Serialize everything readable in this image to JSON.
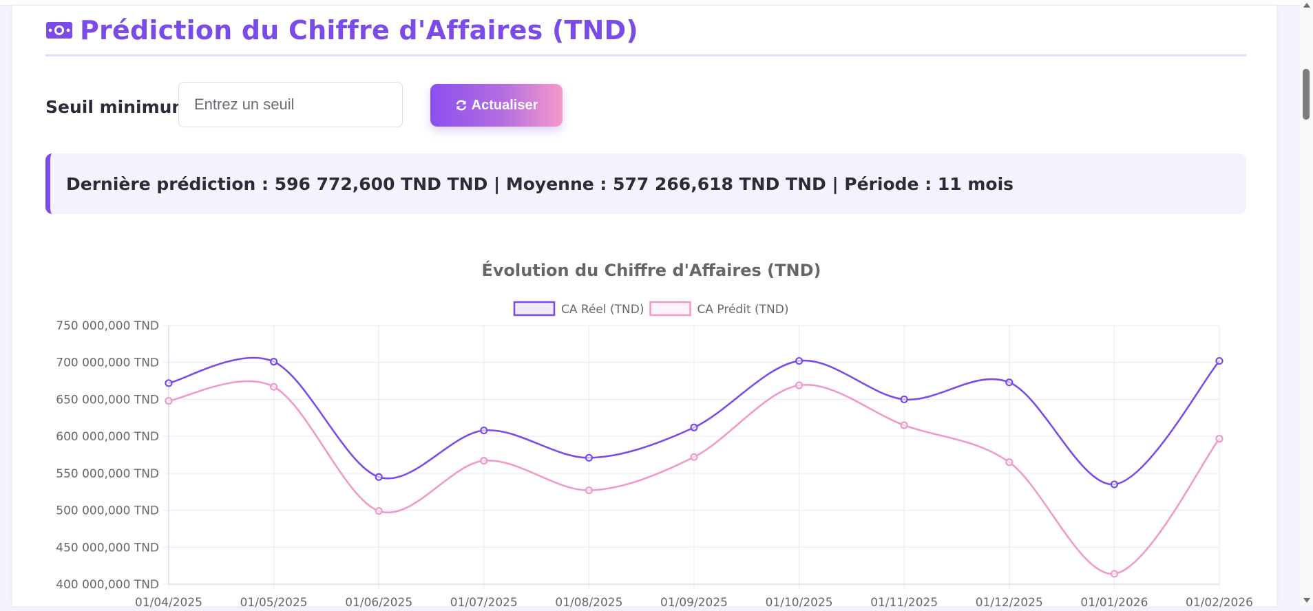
{
  "header": {
    "title": "Prédiction du Chiffre d'Affaires (TND)",
    "icon": "money-bill-icon",
    "accent_color": "#7b4be8"
  },
  "controls": {
    "threshold_label": "Seuil minimum :",
    "threshold_placeholder": "Entrez un seuil",
    "threshold_value": "",
    "refresh_label": "Actualiser",
    "refresh_icon": "refresh-icon"
  },
  "summary": {
    "text": "Dernière prédiction : 596 772,600 TND TND | Moyenne : 577 266,618 TND TND | Période : 11 mois"
  },
  "chart_data": {
    "type": "line",
    "title": "Évolution du Chiffre d'Affaires (TND)",
    "x": [
      "01/04/2025",
      "01/05/2025",
      "01/06/2025",
      "01/07/2025",
      "01/08/2025",
      "01/09/2025",
      "01/10/2025",
      "01/11/2025",
      "01/12/2025",
      "01/01/2026",
      "01/02/2026"
    ],
    "series": [
      {
        "name": "CA Réel (TND)",
        "color": "#7b4be8",
        "values": [
          672000000,
          701000000,
          545000000,
          608000000,
          571000000,
          612000000,
          702000000,
          650000000,
          673000000,
          535000000,
          702000000
        ]
      },
      {
        "name": "CA Prédit (TND)",
        "color": "#f09aca",
        "values": [
          648000000,
          667000000,
          499000000,
          567000000,
          527000000,
          572000000,
          669000000,
          615000000,
          565000000,
          414000000,
          596772600
        ]
      }
    ],
    "yticks": [
      "750 000,000 TND",
      "700 000,000 TND",
      "650 000,000 TND",
      "600 000,000 TND",
      "550 000,000 TND",
      "500 000,000 TND",
      "450 000,000 TND",
      "400 000,000 TND"
    ],
    "ylim": [
      400000000,
      750000000
    ],
    "legend": "top-center",
    "grid": true
  }
}
